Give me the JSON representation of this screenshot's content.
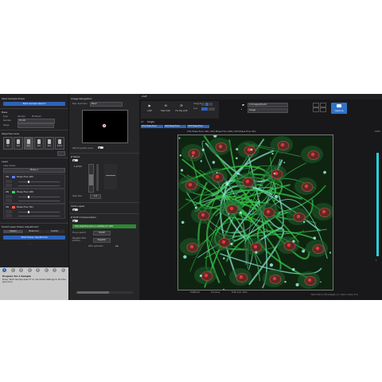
{
  "left": {
    "start_section": "Start Sample Probe",
    "start_button": "Start Sample Search",
    "base_section": "Base",
    "type_label": "Type",
    "type_option_a": "Sample",
    "type_option_b": "Multiwell",
    "sample_label": "Sample",
    "sample_value": "HC-00",
    "stage_label": "Stage",
    "stage_value": "",
    "objective_section": "Objective Lens",
    "objectives": [
      "4x",
      "10x",
      "20x",
      "40x",
      "60x",
      "100x"
    ],
    "laser_section": "Laser",
    "laser_power_label": "Laser Power",
    "laser_power_value": "Phase 1",
    "channels": [
      {
        "name": "Phase Fluor 405",
        "state": "ON"
      },
      {
        "name": "Phase Fluor 488",
        "state": "ON"
      },
      {
        "name": "Phase Fluor 561",
        "state": "ON"
      }
    ],
    "adjust_section": "Smart Laser Power Adjustment",
    "adjust_tabs": [
      "Speed",
      "Balanced",
      "Quality"
    ],
    "adjust_button": "Start Power Adjustment",
    "steps": [
      "1",
      "2",
      "3",
      "4",
      "5",
      "6",
      "7",
      "8"
    ],
    "tip_title": "Prepare for a Sample",
    "tip_text": "Press \"Start Sample Search\" to use Smart Settings to find the specimen."
  },
  "mid": {
    "nav_section": "Image Navigation",
    "mode_label": "Nav resolution",
    "mode_value": "Basic",
    "stitching_label": "Stitching Work Area",
    "zstack_section": "Z Stack",
    "z_top": "1.47um",
    "z_bottom": "Bottom",
    "step_label": "Step Size",
    "step_value": "1.0",
    "time_section": "Time Lapse",
    "refocus_section": "Z Drift Compensation",
    "status_msg": "The objective lens is suitable for ZDC",
    "focus_label": "Focus search",
    "focus_button": "START",
    "register_label": "Register ZDC position",
    "register_button": "Register",
    "zdc_label": "ZDC operation"
  },
  "main": {
    "tab_live": "LIVE",
    "tab_xy": "XY",
    "tab_single": "Single",
    "channel_tags": [
      "CH1 Phase Fluor",
      "CH2 Phase Fluor",
      "CH3 Phase Fluor"
    ],
    "toolbar": [
      {
        "icon": "▶",
        "label": "LIVE"
      },
      {
        "icon": "⟲",
        "label": "Fast LIVE"
      },
      {
        "icon": "⟳",
        "label": "Fix the LIVE"
      }
    ],
    "avg_label": "Integration",
    "avg_sub": "Line",
    "path_value": "C:\\Images\\Exp01",
    "name_value": "Image",
    "capture_label": "Capture",
    "image_header": "CH1 Phase Fluor 405 / CH2 Phase Fluor 488 / CH3 Phase Fluor 561",
    "status_left": "0.000 µm",
    "status_mid": "Focusing",
    "status_right": "Total scan time",
    "status_far": "Stand 0x0.0 / CH3 enlarged: 1x / 1,024 x 1,024 / 0.5 s",
    "scale_top": "100%",
    "scale_bottom": "1"
  }
}
